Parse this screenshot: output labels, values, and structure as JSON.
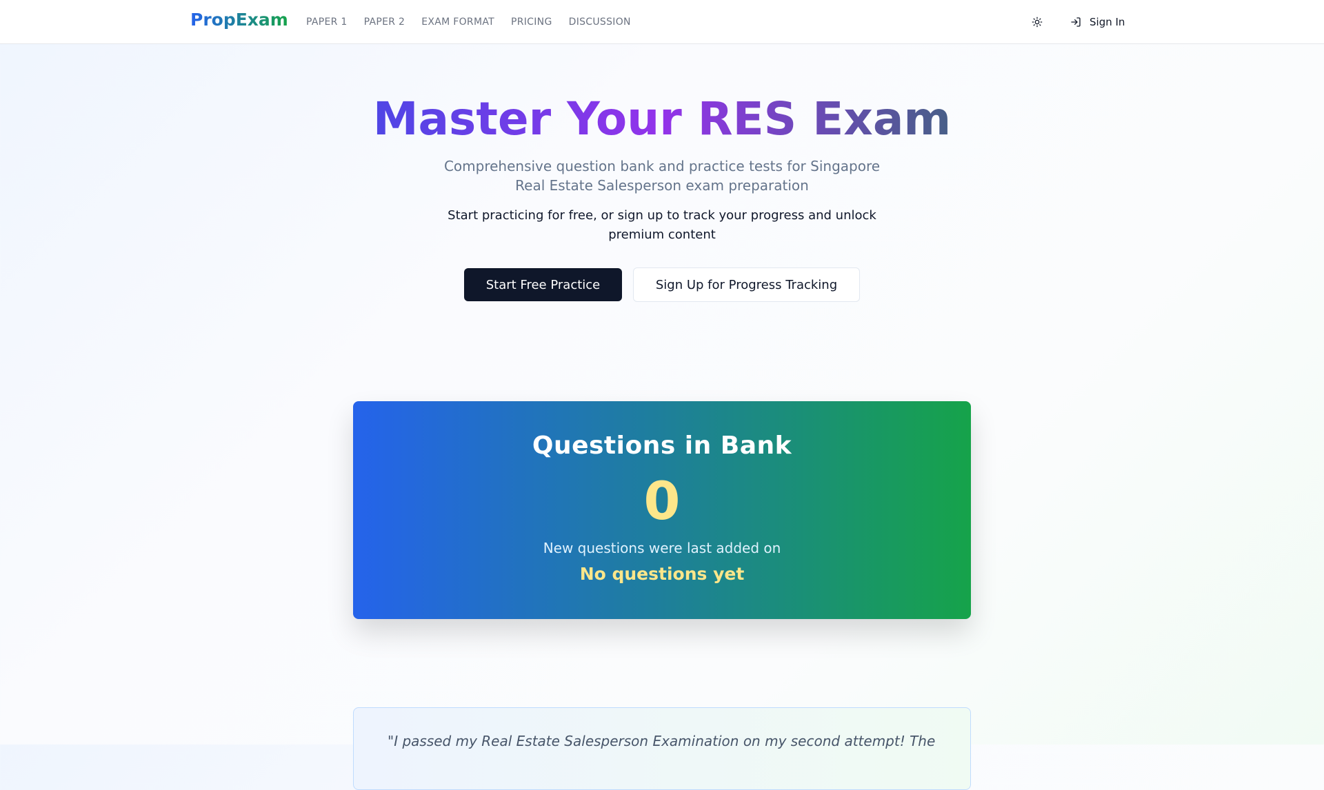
{
  "nav": {
    "brand": "PropExam",
    "links": [
      "PAPER 1",
      "PAPER 2",
      "EXAM FORMAT",
      "PRICING",
      "DISCUSSION"
    ],
    "theme_icon": "sun-icon",
    "signin_icon": "log-in-icon",
    "signin_label": "Sign In"
  },
  "hero": {
    "title": "Master Your RES Exam",
    "subtitle": "Comprehensive question bank and practice tests for Singapore Real Estate Salesperson exam preparation",
    "description": "Start practicing for free, or sign up to track your progress and unlock premium content",
    "primary_button": "Start Free Practice",
    "secondary_button": "Sign Up for Progress Tracking"
  },
  "stats": {
    "title": "Questions in Bank",
    "count": "0",
    "note": "New questions were last added on",
    "last_added": "No questions yet"
  },
  "testimonial": {
    "text": "\"I passed my Real Estate Salesperson Examination on my second attempt! The"
  },
  "colors": {
    "brand_gradient_start": "#2563eb",
    "brand_gradient_end": "#16a34a",
    "title_gradient": [
      "#4f46e5",
      "#9333ea",
      "#475f87"
    ],
    "primary_button": "#0f172a",
    "highlight": "#fde68a"
  }
}
